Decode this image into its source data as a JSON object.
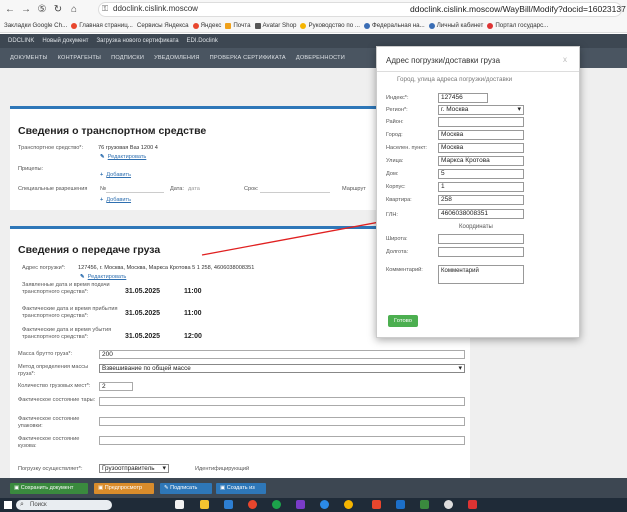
{
  "browser": {
    "tab_short": "ddoclink.cislink.moscow",
    "url": "ddoclink.cislink.moscow/WayBill/Modify?docid=16023137",
    "bookmarks": [
      "Закладки Google Ch...",
      "Главная страниц...",
      "Сервисы Яндекса",
      "Яндекс",
      "Почта",
      "Avatar Shop",
      "Руководство по ...",
      "Федеральная на...",
      "Личный кабинет",
      "Портал государс..."
    ]
  },
  "app_header": {
    "logo": "DDCLINK",
    "items": [
      "Новый документ",
      "Загрузка нового сертификата",
      "EDI.Doclink"
    ]
  },
  "nav": [
    "ДОКУМЕНТЫ",
    "КОНТРАГЕНТЫ",
    "ПОДПИСКИ",
    "УВЕДОМЛЕНИЯ",
    "ПРОВЕРКА СЕРТИФИКАТА",
    "ДОВЕРЕННОСТИ"
  ],
  "transport": {
    "title": "Сведения о транспортном средстве",
    "vehicle_label": "Транспортное средство*:",
    "vehicle_value": "76 грузовая Ваз 1200 4",
    "edit_link": "Редактировать",
    "trailers_label": "Прицепы:",
    "add_link": "Добавить",
    "permits_label": "Специальные разрешения",
    "permit_no": "№",
    "date_label": "Дата:",
    "date_placeholder": "дата",
    "term_label": "Срок:",
    "route_label": "Маршрут",
    "add_link2": "Добавить"
  },
  "cargo": {
    "title": "Сведения о передаче груза",
    "address_label": "Адрес погрузки*:",
    "address_value": "127456, г. Москва, Москва, Маркса Кротова 5 1 258, 4606038008351",
    "edit_link": "Редактировать",
    "declared_label": "Заявленные дата и время подачи транспортного средства*:",
    "declared_date": "31.05.2025",
    "declared_time": "11:00",
    "arrival_label": "Фактические дата и время прибытия транспортного средства*:",
    "arrival_date": "31.05.2025",
    "arrival_time": "11:00",
    "departure_label": "Фактические дата и время убытия транспортного средства*:",
    "departure_date": "31.05.2025",
    "departure_time": "12:00",
    "gross_label": "Масса брутто груза*:",
    "gross_value": "200",
    "method_label": "Метод определения массы груза*:",
    "method_value": "Взвешивание по общей массе",
    "count_label": "Количество грузовых мест*:",
    "count_value": "2",
    "tare_label": "Фактическое состояние тары:",
    "pack_label": "Фактическое состояние упаковки:",
    "body_label": "Фактическое состояние кузова:",
    "loader_label": "Погрузку осуществляет*:",
    "loader_value": "Грузоотправитель",
    "ident_label": "Идентифицирующий"
  },
  "modal": {
    "title": "Адрес погрузки/доставки груза",
    "close": "x",
    "subtitle": "Город, улица адреса погрузки/доставки",
    "fields": [
      {
        "label": "Индекс*:",
        "value": "127456"
      },
      {
        "label": "Регион*:",
        "value": "г. Москва"
      },
      {
        "label": "Район:",
        "value": ""
      },
      {
        "label": "Город:",
        "value": "Москва"
      },
      {
        "label": "Населен. пункт:",
        "value": "Москва"
      },
      {
        "label": "Улица:",
        "value": "Маркса Кротова"
      },
      {
        "label": "Дом:",
        "value": "5"
      },
      {
        "label": "Корпус:",
        "value": "1"
      },
      {
        "label": "Квартира:",
        "value": "258"
      },
      {
        "label": "ГЛН:",
        "value": "4606038008351"
      }
    ],
    "coords_title": "Координаты",
    "lat_label": "Широта:",
    "lon_label": "Долгота:",
    "comment_label": "Комментарий:",
    "comment_value": "Комментарий",
    "ready_button": "Готово"
  },
  "actions": [
    "Сохранить документ",
    "Предпросмотр",
    "Подписать",
    "Создать из"
  ],
  "taskbar": {
    "search_placeholder": "Поиск"
  },
  "colors": {
    "accent": "#2e77b8",
    "ready": "#4caf50",
    "arrow": "#e02020"
  }
}
